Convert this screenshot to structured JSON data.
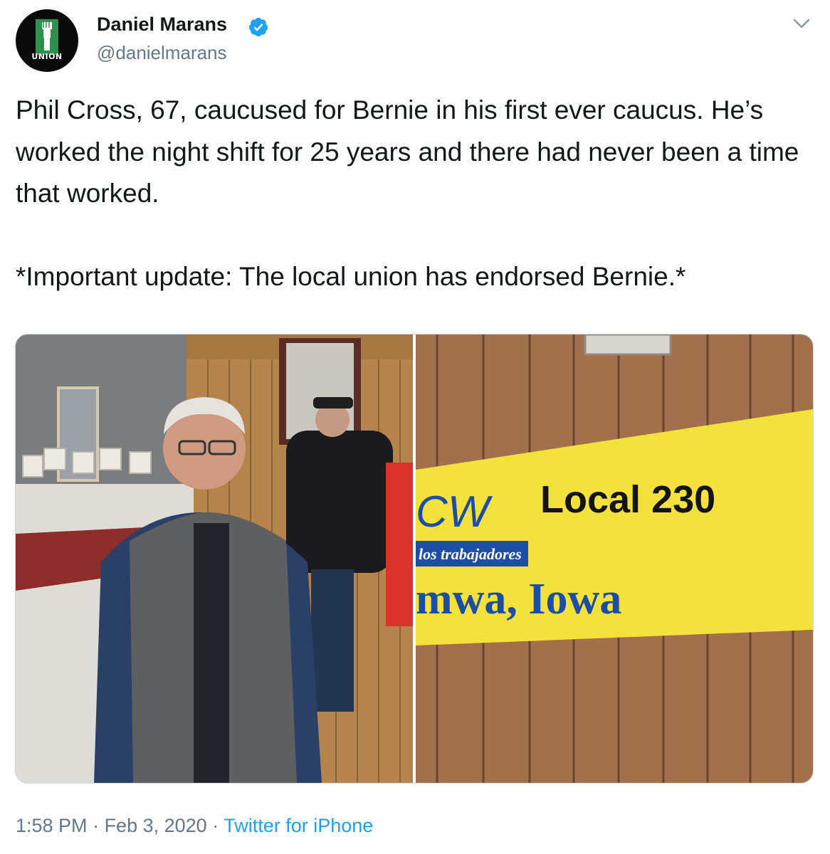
{
  "author": {
    "display_name": "Daniel Marans",
    "handle": "@danielmarans",
    "avatar_text": "UNION",
    "verified": true,
    "verified_color": "#1da1f2"
  },
  "tweet": {
    "paragraph_1": "Phil Cross, 67, caucused for Bernie in his first ever caucus. He’s worked the night shift for 25 years and there had never been a time that worked.",
    "paragraph_2": "*Important update: The local union has endorsed Bernie.*"
  },
  "media": {
    "banner_line_1": "Local 230",
    "banner_logo": "CW",
    "banner_subtext": "los trabajadores",
    "banner_line_2": "mwa, Iowa"
  },
  "meta": {
    "time": "1:58 PM",
    "separator_1": " · ",
    "date": "Feb 3, 2020",
    "separator_2": " · ",
    "source": "Twitter for iPhone",
    "link_color": "#1da1f2"
  }
}
